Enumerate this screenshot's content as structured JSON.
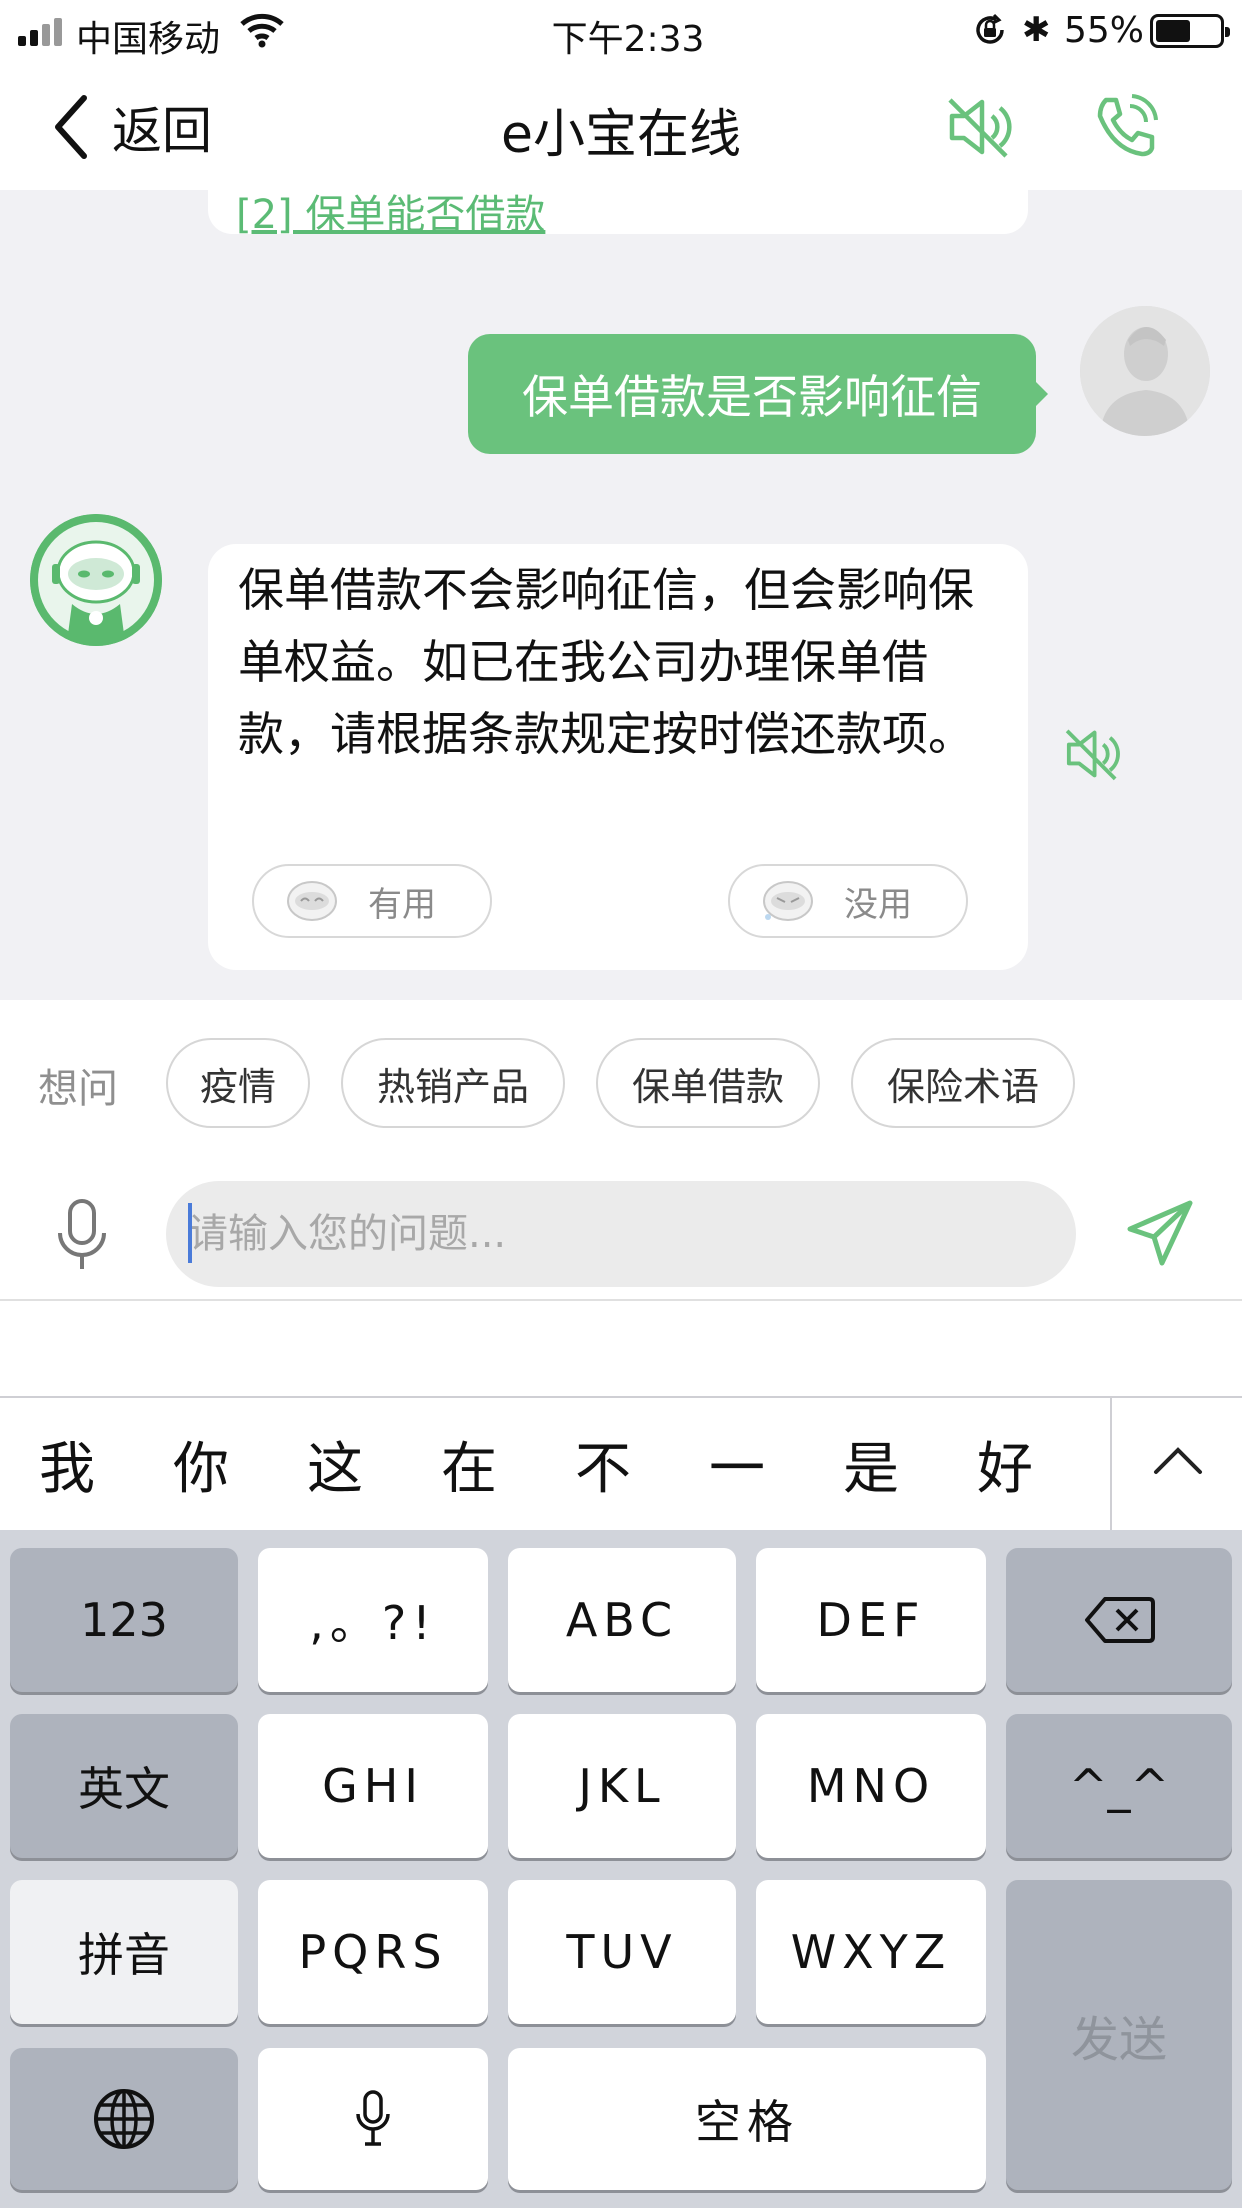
{
  "status_bar": {
    "carrier": "中国移动",
    "time": "下午2:33",
    "battery_percent": "55%",
    "battery_level": 0.55
  },
  "nav": {
    "back_label": "返回",
    "title": "e小宝在线"
  },
  "chat": {
    "previous_link": "[2] 保单能否借款",
    "user_message": "保单借款是否影响征信",
    "bot_message": "保单借款不会影响征信，但会影响保单权益。如已在我公司办理保单借款，请根据条款规定按时偿还款项。",
    "feedback_useful": "有用",
    "feedback_useless": "没用"
  },
  "suggestions": {
    "label": "想问",
    "chips": [
      "疫情",
      "热销产品",
      "保单借款",
      "保险术语"
    ]
  },
  "input": {
    "placeholder": "请输入您的问题..."
  },
  "candidates": [
    "我",
    "你",
    "这",
    "在",
    "不",
    "一",
    "是",
    "好"
  ],
  "keyboard": {
    "row1": [
      "123",
      ",。?!",
      "ABC",
      "DEF"
    ],
    "row2": [
      "英文",
      "GHI",
      "JKL",
      "MNO",
      "^_^"
    ],
    "row3": [
      "拼音",
      "PQRS",
      "TUV",
      "WXYZ"
    ],
    "space": "空格",
    "send": "发送"
  },
  "colors": {
    "accent_green": "#6ac27d",
    "chat_background": "#f1f1f4",
    "keyboard_background": "#d1d4db"
  }
}
